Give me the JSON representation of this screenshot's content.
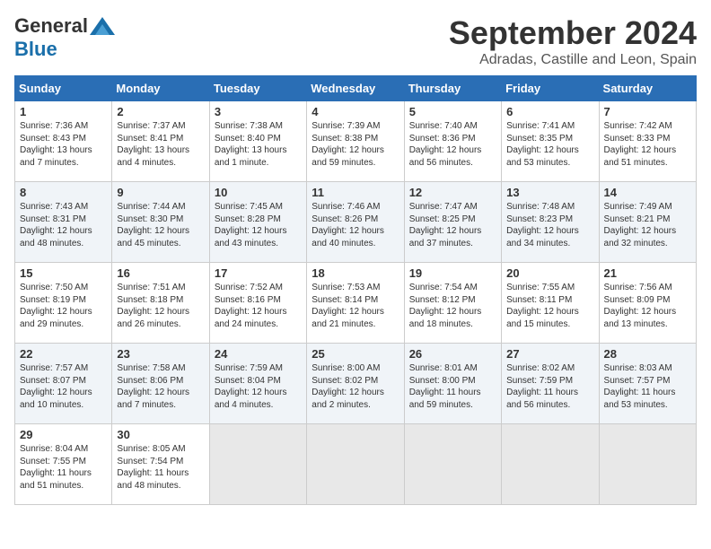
{
  "logo": {
    "general": "General",
    "blue": "Blue"
  },
  "title": "September 2024",
  "location": "Adradas, Castille and Leon, Spain",
  "headers": [
    "Sunday",
    "Monday",
    "Tuesday",
    "Wednesday",
    "Thursday",
    "Friday",
    "Saturday"
  ],
  "weeks": [
    [
      {
        "day": "1",
        "sunrise": "7:36 AM",
        "sunset": "8:43 PM",
        "daylight": "13 hours and 7 minutes."
      },
      {
        "day": "2",
        "sunrise": "7:37 AM",
        "sunset": "8:41 PM",
        "daylight": "13 hours and 4 minutes."
      },
      {
        "day": "3",
        "sunrise": "7:38 AM",
        "sunset": "8:40 PM",
        "daylight": "13 hours and 1 minute."
      },
      {
        "day": "4",
        "sunrise": "7:39 AM",
        "sunset": "8:38 PM",
        "daylight": "12 hours and 59 minutes."
      },
      {
        "day": "5",
        "sunrise": "7:40 AM",
        "sunset": "8:36 PM",
        "daylight": "12 hours and 56 minutes."
      },
      {
        "day": "6",
        "sunrise": "7:41 AM",
        "sunset": "8:35 PM",
        "daylight": "12 hours and 53 minutes."
      },
      {
        "day": "7",
        "sunrise": "7:42 AM",
        "sunset": "8:33 PM",
        "daylight": "12 hours and 51 minutes."
      }
    ],
    [
      {
        "day": "8",
        "sunrise": "7:43 AM",
        "sunset": "8:31 PM",
        "daylight": "12 hours and 48 minutes."
      },
      {
        "day": "9",
        "sunrise": "7:44 AM",
        "sunset": "8:30 PM",
        "daylight": "12 hours and 45 minutes."
      },
      {
        "day": "10",
        "sunrise": "7:45 AM",
        "sunset": "8:28 PM",
        "daylight": "12 hours and 43 minutes."
      },
      {
        "day": "11",
        "sunrise": "7:46 AM",
        "sunset": "8:26 PM",
        "daylight": "12 hours and 40 minutes."
      },
      {
        "day": "12",
        "sunrise": "7:47 AM",
        "sunset": "8:25 PM",
        "daylight": "12 hours and 37 minutes."
      },
      {
        "day": "13",
        "sunrise": "7:48 AM",
        "sunset": "8:23 PM",
        "daylight": "12 hours and 34 minutes."
      },
      {
        "day": "14",
        "sunrise": "7:49 AM",
        "sunset": "8:21 PM",
        "daylight": "12 hours and 32 minutes."
      }
    ],
    [
      {
        "day": "15",
        "sunrise": "7:50 AM",
        "sunset": "8:19 PM",
        "daylight": "12 hours and 29 minutes."
      },
      {
        "day": "16",
        "sunrise": "7:51 AM",
        "sunset": "8:18 PM",
        "daylight": "12 hours and 26 minutes."
      },
      {
        "day": "17",
        "sunrise": "7:52 AM",
        "sunset": "8:16 PM",
        "daylight": "12 hours and 24 minutes."
      },
      {
        "day": "18",
        "sunrise": "7:53 AM",
        "sunset": "8:14 PM",
        "daylight": "12 hours and 21 minutes."
      },
      {
        "day": "19",
        "sunrise": "7:54 AM",
        "sunset": "8:12 PM",
        "daylight": "12 hours and 18 minutes."
      },
      {
        "day": "20",
        "sunrise": "7:55 AM",
        "sunset": "8:11 PM",
        "daylight": "12 hours and 15 minutes."
      },
      {
        "day": "21",
        "sunrise": "7:56 AM",
        "sunset": "8:09 PM",
        "daylight": "12 hours and 13 minutes."
      }
    ],
    [
      {
        "day": "22",
        "sunrise": "7:57 AM",
        "sunset": "8:07 PM",
        "daylight": "12 hours and 10 minutes."
      },
      {
        "day": "23",
        "sunrise": "7:58 AM",
        "sunset": "8:06 PM",
        "daylight": "12 hours and 7 minutes."
      },
      {
        "day": "24",
        "sunrise": "7:59 AM",
        "sunset": "8:04 PM",
        "daylight": "12 hours and 4 minutes."
      },
      {
        "day": "25",
        "sunrise": "8:00 AM",
        "sunset": "8:02 PM",
        "daylight": "12 hours and 2 minutes."
      },
      {
        "day": "26",
        "sunrise": "8:01 AM",
        "sunset": "8:00 PM",
        "daylight": "11 hours and 59 minutes."
      },
      {
        "day": "27",
        "sunrise": "8:02 AM",
        "sunset": "7:59 PM",
        "daylight": "11 hours and 56 minutes."
      },
      {
        "day": "28",
        "sunrise": "8:03 AM",
        "sunset": "7:57 PM",
        "daylight": "11 hours and 53 minutes."
      }
    ],
    [
      {
        "day": "29",
        "sunrise": "8:04 AM",
        "sunset": "7:55 PM",
        "daylight": "11 hours and 51 minutes."
      },
      {
        "day": "30",
        "sunrise": "8:05 AM",
        "sunset": "7:54 PM",
        "daylight": "11 hours and 48 minutes."
      },
      null,
      null,
      null,
      null,
      null
    ]
  ],
  "labels": {
    "sunrise": "Sunrise:",
    "sunset": "Sunset:",
    "daylight": "Daylight:"
  }
}
